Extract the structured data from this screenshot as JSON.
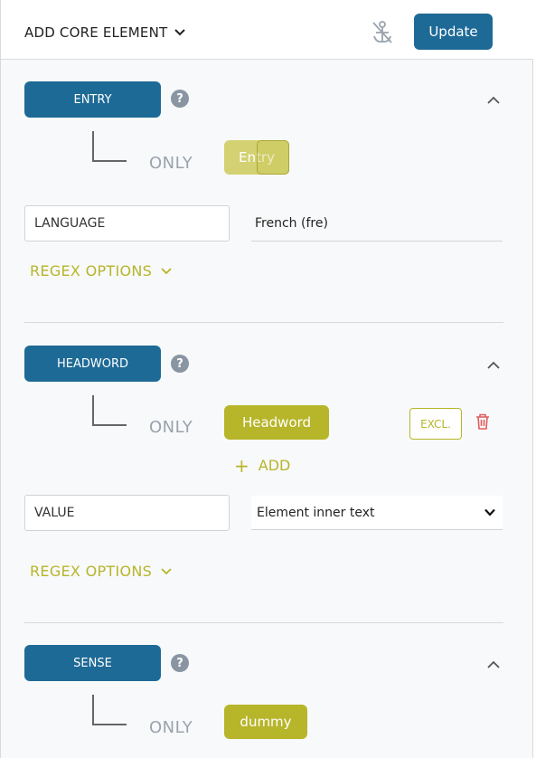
{
  "header": {
    "add_core_label": "ADD CORE ELEMENT",
    "update_label": "Update"
  },
  "sections": [
    {
      "name": "ENTRY",
      "help": "?",
      "only_label": "ONLY",
      "tag": "Entry",
      "field_label": "LANGUAGE",
      "field_value": "French (fre)",
      "regex_label": "REGEX OPTIONS"
    },
    {
      "name": "HEADWORD",
      "help": "?",
      "only_label": "ONLY",
      "tag": "Headword",
      "excl_label": "EXCL.",
      "add_label": "ADD",
      "field_label": "VALUE",
      "field_value": "Element inner text",
      "regex_label": "REGEX OPTIONS"
    },
    {
      "name": "SENSE",
      "help": "?",
      "only_label": "ONLY",
      "tag": "dummy"
    }
  ],
  "colors": {
    "primary": "#1e6a96",
    "accent": "#b7b52a",
    "danger": "#e25c5c",
    "muted": "#9aa3ad"
  },
  "icons": [
    "chevron-down-icon",
    "anchor-off-icon",
    "help-icon",
    "chevron-up-icon",
    "trash-icon",
    "plus-icon"
  ]
}
